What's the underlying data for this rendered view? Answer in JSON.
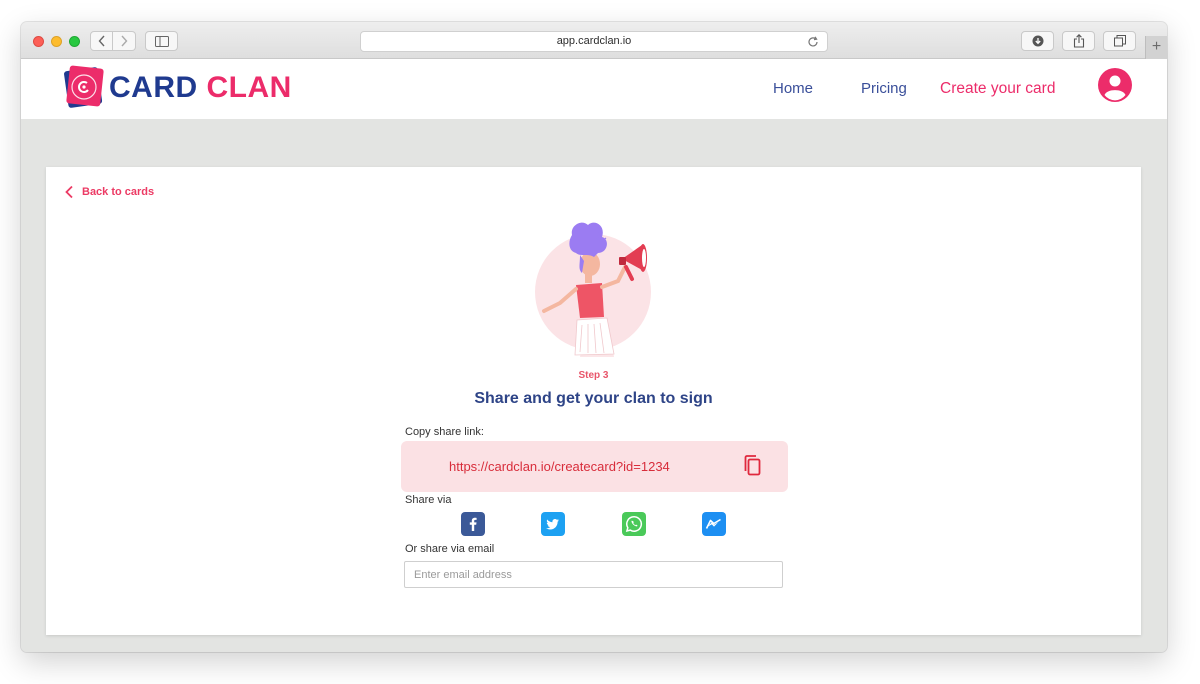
{
  "browser": {
    "url": "app.cardclan.io"
  },
  "header": {
    "logo": {
      "part1": "CARD",
      "part2": "CLAN"
    },
    "nav": {
      "home": "Home",
      "pricing": "Pricing",
      "create": "Create your card"
    }
  },
  "page": {
    "back_label": "Back to cards",
    "step_label": "Step 3",
    "title": "Share and get your clan to sign",
    "copy_label": "Copy share link:",
    "share_link": "https://cardclan.io/createcard?id=1234",
    "share_via_label": "Share via",
    "social": [
      "facebook-icon",
      "twitter-icon",
      "whatsapp-icon",
      "messenger-icon"
    ],
    "email_label": "Or share via email",
    "email_placeholder": "Enter email address"
  },
  "colors": {
    "brand_pink": "#ec2c6a",
    "brand_navy": "#1f3a8f",
    "link_box_bg": "#fbe1e4",
    "facebook": "#3b5998",
    "twitter": "#1da1f2",
    "whatsapp": "#4ac959",
    "messenger": "#1d8ff2"
  }
}
